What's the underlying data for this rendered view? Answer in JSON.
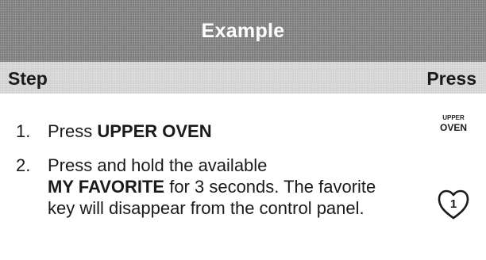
{
  "title": "Example",
  "header": {
    "step": "Step",
    "press": "Press"
  },
  "steps": [
    {
      "number": "1.",
      "text_before": "Press ",
      "bold": "UPPER OVEN",
      "text_after": "",
      "press_key": {
        "line1": "UPPER",
        "line2": "OVEN"
      }
    },
    {
      "number": "2.",
      "text_before": "Press and hold the available",
      "bold": "MY FAVORITE",
      "text_after": " for 3 seconds. The favorite key will disappear from the control panel.",
      "press_key": {
        "icon": "heart-icon",
        "label": "1"
      }
    }
  ]
}
